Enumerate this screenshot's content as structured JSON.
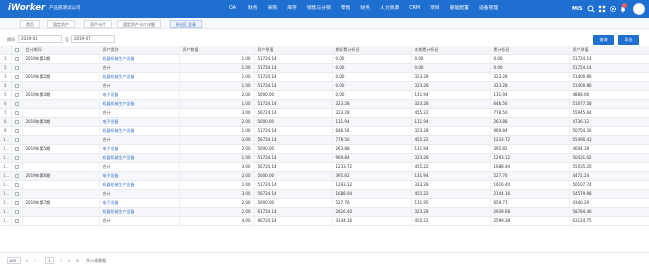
{
  "app": {
    "logo": "iWorker",
    "company": "产品部测试公司",
    "nav": [
      "OA",
      "财务",
      "采购",
      "库存",
      "销售与分销",
      "零售",
      "财务",
      "人力资源",
      "CRM",
      "项目",
      "基础配置",
      "设备管理"
    ],
    "user": "MIS",
    "accent": "#1e6fd0"
  },
  "tabs": [
    "首页",
    "固定资产",
    "资产卡片",
    "固定资产卡片详细",
    "折旧汇总表"
  ],
  "filter": {
    "from_label": "期间",
    "from_value": "2019-01",
    "to_label": "至",
    "to_value": "2019-07",
    "query_label": "查询",
    "export_label": "导出"
  },
  "table": {
    "headers": [
      "",
      "",
      "会计期间",
      "资产类别",
      "资产数量",
      "资产原值",
      "期初累计折旧",
      "本期累计折旧",
      "累计折旧",
      "资产净值"
    ],
    "rows": [
      {
        "idx": "1",
        "period": "2019年第1期",
        "cat": "机器机械生产设备",
        "qty": "1.00",
        "orig": "51724.14",
        "open": "0.00",
        "cur": "0.00",
        "acc": "0.00",
        "net": "51724.14"
      },
      {
        "idx": "2",
        "period": "",
        "cat": "合计",
        "qty": "1.00",
        "orig": "51724.14",
        "open": "0.00",
        "cur": "0.00",
        "acc": "0.00",
        "net": "51724.14"
      },
      {
        "idx": "3",
        "period": "2019年第2期",
        "cat": "机器机械生产设备",
        "qty": "1.00",
        "orig": "51724.14",
        "open": "0.00",
        "cur": "323.28",
        "acc": "323.28",
        "net": "51400.86"
      },
      {
        "idx": "4",
        "period": "",
        "cat": "合计",
        "qty": "1.00",
        "orig": "51724.14",
        "open": "0.00",
        "cur": "323.28",
        "acc": "323.28",
        "net": "51400.86"
      },
      {
        "idx": "5",
        "period": "2019年第3期",
        "cat": "电子设备",
        "qty": "2.00",
        "orig": "5000.00",
        "open": "0.00",
        "cur": "131.94",
        "acc": "131.94",
        "net": "4868.06"
      },
      {
        "idx": "6",
        "period": "",
        "cat": "机器机械生产设备",
        "qty": "1.00",
        "orig": "51724.14",
        "open": "323.28",
        "cur": "323.28",
        "acc": "646.56",
        "net": "51077.58"
      },
      {
        "idx": "7",
        "period": "",
        "cat": "合计",
        "qty": "3.00",
        "orig": "56724.14",
        "open": "323.28",
        "cur": "455.22",
        "acc": "778.50",
        "net": "55945.64"
      },
      {
        "idx": "8",
        "period": "2019年第4期",
        "cat": "电子设备",
        "qty": "2.00",
        "orig": "5000.00",
        "open": "131.94",
        "cur": "131.94",
        "acc": "263.88",
        "net": "4736.12"
      },
      {
        "idx": "9",
        "period": "",
        "cat": "机器机械生产设备",
        "qty": "1.00",
        "orig": "51724.14",
        "open": "646.56",
        "cur": "323.28",
        "acc": "969.84",
        "net": "50754.30"
      },
      {
        "idx": "10",
        "period": "",
        "cat": "合计",
        "qty": "3.00",
        "orig": "56724.14",
        "open": "778.50",
        "cur": "455.22",
        "acc": "1233.72",
        "net": "55490.42"
      },
      {
        "idx": "11",
        "period": "2019年第5期",
        "cat": "电子设备",
        "qty": "2.00",
        "orig": "5000.00",
        "open": "263.88",
        "cur": "131.94",
        "acc": "395.82",
        "net": "4604.18"
      },
      {
        "idx": "12",
        "period": "",
        "cat": "机器机械生产设备",
        "qty": "1.00",
        "orig": "51724.14",
        "open": "969.84",
        "cur": "323.28",
        "acc": "1293.12",
        "net": "50431.02"
      },
      {
        "idx": "13",
        "period": "",
        "cat": "合计",
        "qty": "3.00",
        "orig": "56724.14",
        "open": "1233.72",
        "cur": "455.22",
        "acc": "1688.94",
        "net": "55035.20"
      },
      {
        "idx": "14",
        "period": "2019年第6期",
        "cat": "电子设备",
        "qty": "2.00",
        "orig": "5000.00",
        "open": "395.82",
        "cur": "131.94",
        "acc": "527.76",
        "net": "4472.24"
      },
      {
        "idx": "15",
        "period": "",
        "cat": "机器机械生产设备",
        "qty": "1.00",
        "orig": "51724.14",
        "open": "1293.12",
        "cur": "323.28",
        "acc": "1616.40",
        "net": "50107.74"
      },
      {
        "idx": "16",
        "period": "",
        "cat": "合计",
        "qty": "3.00",
        "orig": "56724.14",
        "open": "1688.94",
        "cur": "455.22",
        "acc": "2144.16",
        "net": "54579.98"
      },
      {
        "idx": "17",
        "period": "2019年第7期",
        "cat": "电子设备",
        "qty": "2.00",
        "orig": "5000.00",
        "open": "527.76",
        "cur": "131.95",
        "acc": "659.71",
        "net": "4340.29"
      },
      {
        "idx": "18",
        "period": "",
        "cat": "机器机械生产设备",
        "qty": "2.00",
        "orig": "61724.14",
        "open": "2616.40",
        "cur": "323.28",
        "acc": "2939.68",
        "net": "58784.46"
      },
      {
        "idx": "19",
        "period": "",
        "cat": "合计",
        "qty": "4.00",
        "orig": "66724.14",
        "open": "3144.16",
        "cur": "455.22",
        "acc": "2599.38",
        "net": "63124.75"
      }
    ]
  },
  "pager": {
    "page_size": "100",
    "current": "1",
    "summary": "共19条数据"
  }
}
